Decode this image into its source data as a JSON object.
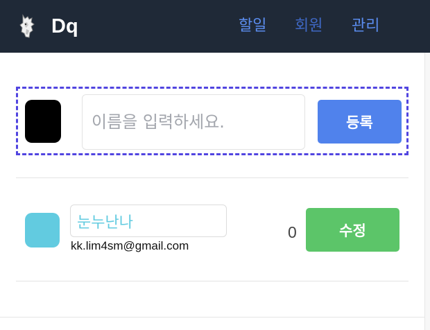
{
  "header": {
    "brand": "Dq",
    "logo_icon": "fox-logo-icon",
    "nav": [
      {
        "label": "할일",
        "active": false
      },
      {
        "label": "회원",
        "active": true
      },
      {
        "label": "관리",
        "active": false
      }
    ]
  },
  "register": {
    "swatch_color": "#000000",
    "name_placeholder": "이름을 입력하세요.",
    "name_value": "",
    "submit_label": "등록"
  },
  "members": [
    {
      "color": "#62cbe0",
      "name": "눈누난나",
      "email": "kk.lim4sm@gmail.com",
      "count": "0",
      "edit_label": "수정"
    }
  ],
  "colors": {
    "navbar": "#1f2937",
    "nav_link": "#5b8def",
    "register_border": "#5145e0",
    "register_button": "#5082ec",
    "edit_button": "#5cc569"
  }
}
